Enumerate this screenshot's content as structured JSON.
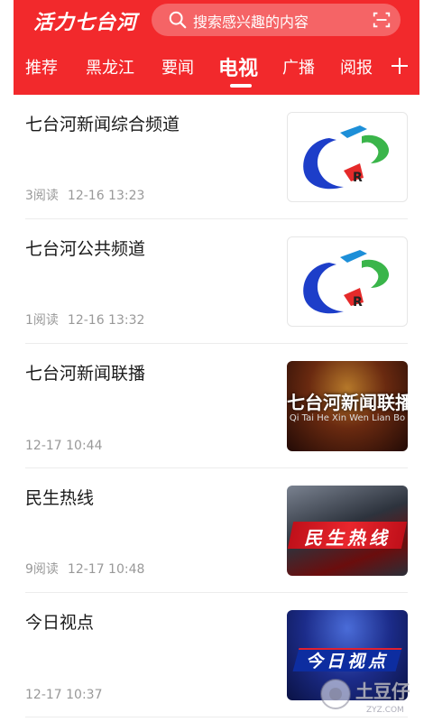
{
  "header": {
    "logo": "活力七台河",
    "search_placeholder": "搜索感兴趣的内容",
    "background_color": "#f2292c"
  },
  "tabs": [
    {
      "label": "推荐",
      "active": false
    },
    {
      "label": "黑龙江",
      "active": false
    },
    {
      "label": "要闻",
      "active": false
    },
    {
      "label": "电视",
      "active": true
    },
    {
      "label": "广播",
      "active": false
    },
    {
      "label": "阅报",
      "active": false
    }
  ],
  "feed": [
    {
      "title": "七台河新闻综合频道",
      "reads": "3阅读",
      "time": "12-16 13:23",
      "thumb": "station-logo"
    },
    {
      "title": "七台河公共频道",
      "reads": "1阅读",
      "time": "12-16 13:32",
      "thumb": "station-logo"
    },
    {
      "title": "七台河新闻联播",
      "reads": "",
      "time": "12-17 10:44",
      "thumb": "news-broadcast",
      "caption_cn": "七台河新闻联播",
      "caption_py": "Qi Tai He Xin Wen Lian Bo"
    },
    {
      "title": "民生热线",
      "reads": "9阅读",
      "time": "12-17 10:48",
      "thumb": "hotline",
      "caption_cn": "民生热线"
    },
    {
      "title": "今日视点",
      "reads": "",
      "time": "12-17 10:37",
      "thumb": "today-viewpoint",
      "caption_cn": "今日视点"
    }
  ],
  "watermark": {
    "text": "土豆仔",
    "subtext": "ZYZ.COM"
  }
}
